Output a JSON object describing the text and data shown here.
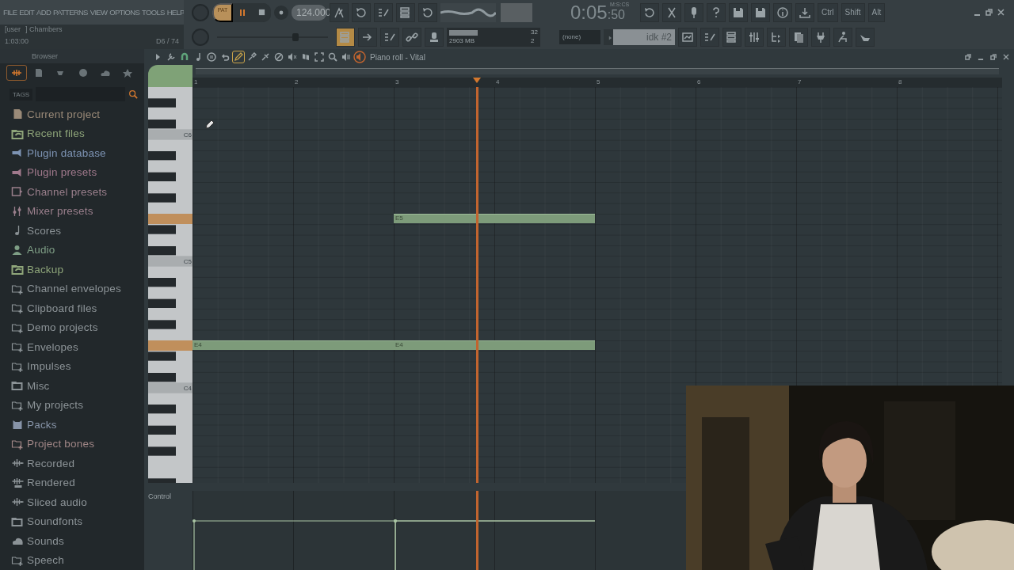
{
  "menu": [
    "FILE",
    "EDIT",
    "ADD",
    "PATTERNS",
    "VIEW",
    "OPTIONS",
    "TOOLS",
    "HELP"
  ],
  "hint": {
    "user": "[user",
    "title": "] Chambers",
    "time": "1:03:00",
    "count": "D6 / 74"
  },
  "transport": {
    "mode": "PAT",
    "playing": true
  },
  "tempo": "124.000",
  "clock": {
    "main": "0:05",
    "sub": ":50",
    "unit": "M:S:CS"
  },
  "modifier_keys": [
    "Ctrl",
    "Shift",
    "Alt"
  ],
  "cpu": {
    "level": 0.35,
    "polyphony": "32",
    "memory": "2903 MB",
    "voices": "2"
  },
  "snap": "(none)",
  "pattern": "idk #2",
  "browser": {
    "title": "Browser",
    "tags_label": "TAGS",
    "tabs": [
      {
        "selected": true
      },
      {
        "selected": false
      },
      {
        "selected": false
      },
      {
        "selected": false
      },
      {
        "selected": false
      },
      {
        "selected": false
      }
    ],
    "items": [
      {
        "label": "Current project",
        "kind": "file",
        "color": "#9a8a78"
      },
      {
        "label": "Recent files",
        "kind": "sync",
        "color": "#8fa67a"
      },
      {
        "label": "Plugin database",
        "kind": "plugin",
        "color": "#7d93b3"
      },
      {
        "label": "Plugin presets",
        "kind": "plugin",
        "color": "#a0798c"
      },
      {
        "label": "Channel presets",
        "kind": "channel",
        "color": "#9a7f8c"
      },
      {
        "label": "Mixer presets",
        "kind": "mixer",
        "color": "#9a7f8c"
      },
      {
        "label": "Scores",
        "kind": "note",
        "color": "#8c9397"
      },
      {
        "label": "Audio",
        "kind": "person",
        "color": "#7f9f86"
      },
      {
        "label": "Backup",
        "kind": "sync",
        "color": "#8fa67a"
      },
      {
        "label": "Channel envelopes",
        "kind": "folder-plus",
        "color": "#8c9397"
      },
      {
        "label": "Clipboard files",
        "kind": "folder-plus",
        "color": "#8c9397"
      },
      {
        "label": "Demo projects",
        "kind": "folder-plus",
        "color": "#8c9397"
      },
      {
        "label": "Envelopes",
        "kind": "folder-plus",
        "color": "#8c9397"
      },
      {
        "label": "Impulses",
        "kind": "folder-plus",
        "color": "#8c9397"
      },
      {
        "label": "Misc",
        "kind": "folder",
        "color": "#8c9397"
      },
      {
        "label": "My projects",
        "kind": "folder-plus",
        "color": "#8c9397"
      },
      {
        "label": "Packs",
        "kind": "box",
        "color": "#8794a8"
      },
      {
        "label": "Project bones",
        "kind": "folder-plus",
        "color": "#a08686"
      },
      {
        "label": "Recorded",
        "kind": "wave",
        "color": "#8c9397"
      },
      {
        "label": "Rendered",
        "kind": "rendered",
        "color": "#8c9397"
      },
      {
        "label": "Sliced audio",
        "kind": "wave",
        "color": "#8c9397"
      },
      {
        "label": "Soundfonts",
        "kind": "folder",
        "color": "#8c9397"
      },
      {
        "label": "Sounds",
        "kind": "cloud",
        "color": "#8c9397"
      },
      {
        "label": "Speech",
        "kind": "folder-plus",
        "color": "#8c9397"
      }
    ]
  },
  "piano_roll": {
    "title": "Piano roll - Vital",
    "tools": [
      {
        "selected": true
      },
      {
        "selected": false
      },
      {
        "selected": false
      },
      {
        "selected": false
      },
      {
        "selected": false
      },
      {
        "selected": false
      },
      {
        "selected": false
      },
      {
        "selected": false
      },
      {
        "selected": false
      }
    ],
    "bars": [
      "1",
      "2",
      "3",
      "4",
      "5",
      "6",
      "7",
      "8"
    ],
    "key_labels": [
      "C6",
      "C5",
      "C4"
    ],
    "key_highlights": [
      {
        "on": true
      },
      {
        "on": true
      }
    ],
    "notes": [
      {
        "label": "E5"
      },
      {
        "label": "E4"
      },
      {
        "label": "E4"
      }
    ],
    "control_label": "Control"
  },
  "webcam": {
    "kind": "picture"
  }
}
